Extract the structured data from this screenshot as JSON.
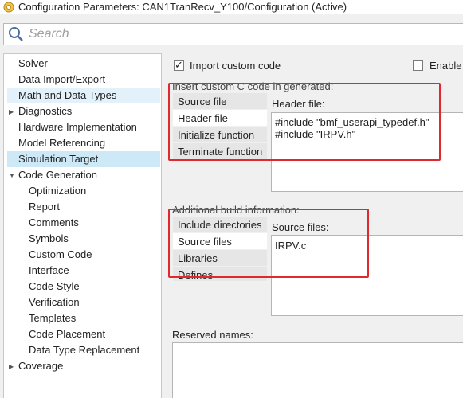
{
  "window": {
    "title": "Configuration Parameters: CAN1TranRecv_Y100/Configuration (Active)"
  },
  "search": {
    "placeholder": "Search"
  },
  "tree": {
    "items": [
      {
        "label": "Solver"
      },
      {
        "label": "Data Import/Export"
      },
      {
        "label": "Math and Data Types"
      },
      {
        "label": "Diagnostics"
      },
      {
        "label": "Hardware Implementation"
      },
      {
        "label": "Model Referencing"
      },
      {
        "label": "Simulation Target"
      },
      {
        "label": "Code Generation"
      },
      {
        "label": "Optimization"
      },
      {
        "label": "Report"
      },
      {
        "label": "Comments"
      },
      {
        "label": "Symbols"
      },
      {
        "label": "Custom Code"
      },
      {
        "label": "Interface"
      },
      {
        "label": "Code Style"
      },
      {
        "label": "Verification"
      },
      {
        "label": "Templates"
      },
      {
        "label": "Code Placement"
      },
      {
        "label": "Data Type Replacement"
      },
      {
        "label": "Coverage"
      }
    ]
  },
  "main": {
    "import_custom_code": {
      "label": "Import custom code",
      "checked": true
    },
    "enable_label": "Enable",
    "insert_section_label": "Insert custom C code in generated:",
    "insert_tabs": [
      "Source file",
      "Header file",
      "Initialize function",
      "Terminate function"
    ],
    "header_file_label": "Header file:",
    "header_code_lines": [
      "#include \"bmf_userapi_typedef.h\"",
      "#include \"IRPV.h\""
    ],
    "build_section_label": "Additional build information:",
    "build_tabs": [
      "Include directories",
      "Source files",
      "Libraries",
      "Defines"
    ],
    "source_files_label": "Source files:",
    "source_files_lines": [
      "IRPV.c"
    ],
    "reserved_names_label": "Reserved names:"
  },
  "colors": {
    "annotation_red": "#e0292e",
    "selection_blue": "#cde8f7"
  }
}
